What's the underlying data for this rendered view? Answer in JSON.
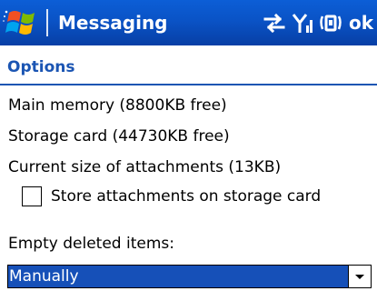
{
  "titlebar": {
    "app_title": "Messaging",
    "ok_label": "ok",
    "start_icon": "windows-flag-icon",
    "sync_icon": "sync-arrows-icon",
    "signal_icon": "antenna-signal-icon",
    "volume_icon": "volume-icon",
    "background_color": "#0a53c6"
  },
  "page": {
    "title": "Options",
    "accent_color": "#1b55b3"
  },
  "info": {
    "main_memory": "Main memory (8800KB free)",
    "storage_card": "Storage card (44730KB free)",
    "attachments_size": "Current size of attachments (13KB)"
  },
  "store_attachments": {
    "label": "Store attachments on storage card",
    "checked": false
  },
  "empty_deleted": {
    "label": "Empty deleted items:",
    "selected": "Manually",
    "selection_color": "#1650b8"
  }
}
